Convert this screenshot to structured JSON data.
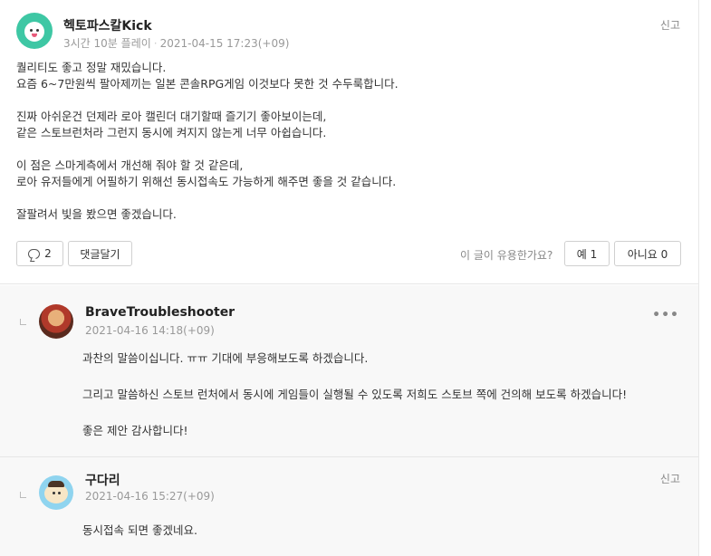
{
  "review": {
    "author": "헥토파스칼Kick",
    "playtime": "3시간 10분 플레이",
    "date": "2021-04-15 17:23(+09)",
    "report_label": "신고",
    "paragraphs": [
      [
        "퀄리티도 좋고 정말 재밌습니다.",
        "요즘 6~7만원씩 팔아제끼는 일본 콘솔RPG게임 이것보다 못한 것 수두룩합니다."
      ],
      [
        "진짜 아쉬운건 던제라 로아 캘린더 대기할때 즐기기 좋아보이는데,",
        "같은 스토브런처라 그런지 동시에 켜지지 않는게 너무 아쉽습니다."
      ],
      [
        "이 점은 스마게측에서 개선해 줘야 할 것 같은데,",
        "로아 유저들에게 어필하기 위해선 동시접속도 가능하게 해주면 좋을 것 같습니다."
      ],
      [
        "잘팔려서 빛을 봤으면 좋겠습니다."
      ]
    ],
    "comment_count": "2",
    "reply_label": "댓글달기",
    "helpful_question": "이 글이 유용한가요?",
    "yes_label": "예 1",
    "no_label": "아니요 0"
  },
  "comments": [
    {
      "author": "BraveTroubleshooter",
      "date": "2021-04-16 14:18(+09)",
      "more_label": "•••",
      "paragraphs": [
        [
          "과찬의 말씀이십니다. ㅠㅠ 기대에 부응해보도록 하겠습니다."
        ],
        [
          "그리고 말씀하신 스토브 런처에서 동시에 게임들이 실행될 수 있도록 저희도 스토브 쪽에 건의해 보도록 하겠습니다!"
        ],
        [
          "좋은 제안 감사합니다!"
        ]
      ]
    },
    {
      "author": "구다리",
      "date": "2021-04-16 15:27(+09)",
      "report_label": "신고",
      "paragraphs": [
        [
          "동시접속 되면 좋겠네요."
        ]
      ]
    }
  ],
  "colors": {
    "avatar_main": "#3ec7a4",
    "comment_bg": "#f8f8f8",
    "meta_text": "#999999"
  }
}
